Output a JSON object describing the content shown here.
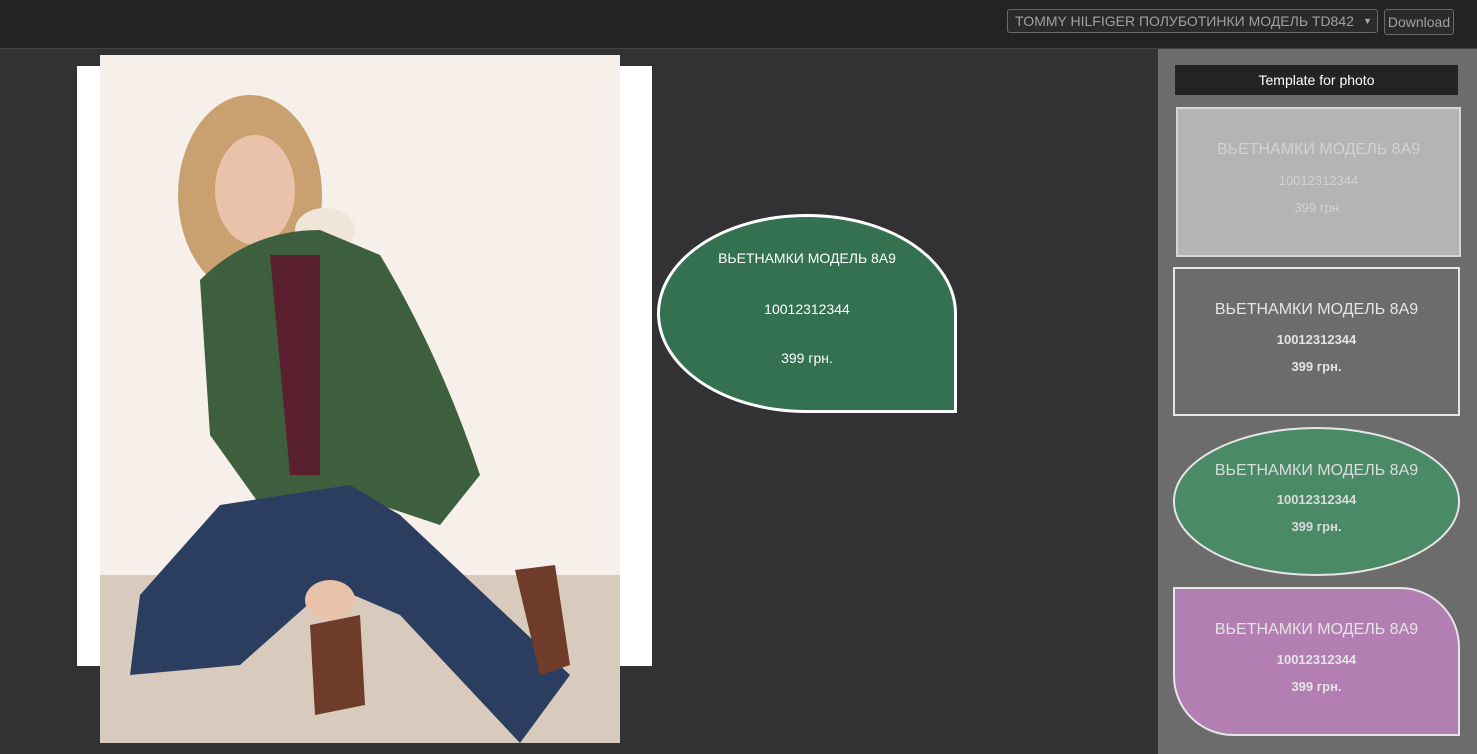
{
  "toolbar": {
    "product_select_value": "TOMMY HILFIGER ПОЛУБОТИНКИ МОДЕЛЬ TD842",
    "download_label": "Download"
  },
  "label": {
    "name": "ВЬЕТНАМКИ МОДЕЛЬ 8А9",
    "sku": "10012312344",
    "price": "399 грн.",
    "color": "#337150"
  },
  "sidebar": {
    "title": "Template for photo",
    "templates": [
      {
        "name": "ВЬЕТНАМКИ МОДЕЛЬ 8А9",
        "sku": "10012312344",
        "price": "399 грн.",
        "color": "#b4b4b4"
      },
      {
        "name": "ВЬЕТНАМКИ МОДЕЛЬ 8А9",
        "sku": "10012312344",
        "price": "399 грн.",
        "color": "#6c6c6c"
      },
      {
        "name": "ВЬЕТНАМКИ МОДЕЛЬ 8А9",
        "sku": "10012312344",
        "price": "399 грн.",
        "color": "#4a8a67"
      },
      {
        "name": "ВЬЕТНАМКИ МОДЕЛЬ 8А9",
        "sku": "10012312344",
        "price": "399 грн.",
        "color": "#b37fb3"
      }
    ]
  },
  "colors": {
    "background": "#323234",
    "topbar": "#232323",
    "sidebar": "#6c6c6c"
  }
}
